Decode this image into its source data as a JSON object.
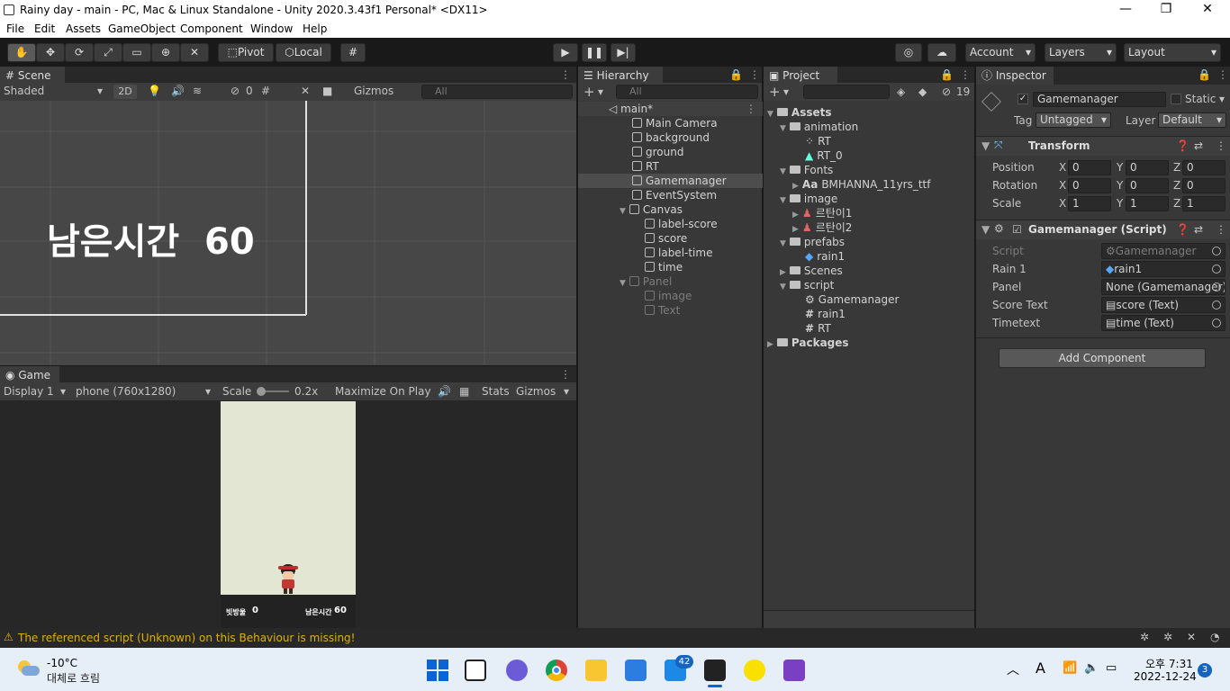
{
  "window": {
    "title": "Rainy day - main - PC, Mac & Linux Standalone - Unity 2020.3.43f1 Personal* <DX11>"
  },
  "menu": [
    "File",
    "Edit",
    "Assets",
    "GameObject",
    "Component",
    "Window",
    "Help"
  ],
  "toolbar": {
    "pivot": "Pivot",
    "local": "Local",
    "account": "Account",
    "layers": "Layers",
    "layout": "Layout"
  },
  "scene": {
    "tab": "Scene",
    "shading": "Shaded",
    "mode2d": "2D",
    "hidden_count": "0",
    "gizmos": "Gizmos",
    "search_placeholder": "All",
    "overlay_text": "남은시간  60"
  },
  "game": {
    "tab": "Game",
    "display": "Display 1",
    "resolution": "phone (760x1280)",
    "scale_label": "Scale",
    "scale_value": "0.2x",
    "maximize": "Maximize On Play",
    "stats": "Stats",
    "gizmos": "Gizmos",
    "score_label": "빗방울",
    "score_value": "0",
    "time_label": "남은시간",
    "time_value": "60"
  },
  "hierarchy": {
    "tab": "Hierarchy",
    "search_placeholder": "All",
    "scene_name": "main*",
    "items": [
      "Main Camera",
      "background",
      "ground",
      "RT",
      "Gamemanager",
      "EventSystem",
      "Canvas",
      "label-score",
      "score",
      "label-time",
      "time",
      "Panel",
      "image",
      "Text"
    ]
  },
  "project": {
    "tab": "Project",
    "hidden_count": "19",
    "items": [
      "Assets",
      "animation",
      "RT",
      "RT_0",
      "Fonts",
      "BMHANNA_11yrs_ttf",
      "image",
      "르탄이1",
      "르탄이2",
      "prefabs",
      "rain1",
      "Scenes",
      "script",
      "Gamemanager",
      "rain1",
      "RT",
      "Packages"
    ]
  },
  "inspector": {
    "tab": "Inspector",
    "object_name": "Gamemanager",
    "static": "Static",
    "tag_label": "Tag",
    "tag": "Untagged",
    "layer_label": "Layer",
    "layer": "Default",
    "transform": {
      "title": "Transform",
      "position": "Position",
      "rotation": "Rotation",
      "scale": "Scale",
      "px": "0",
      "py": "0",
      "pz": "0",
      "rx": "0",
      "ry": "0",
      "rz": "0",
      "sx": "1",
      "sy": "1",
      "sz": "1"
    },
    "script": {
      "title": "Gamemanager (Script)",
      "script_label": "Script",
      "script_value": "Gamemanager",
      "rain_label": "Rain 1",
      "rain_value": "rain1",
      "panel_label": "Panel",
      "panel_value": "None (Gamemanager)",
      "score_label": "Score Text",
      "score_value": "score (Text)",
      "time_label": "Timetext",
      "time_value": "time (Text)"
    },
    "add_component": "Add Component"
  },
  "status": {
    "warning": "The referenced script (Unknown) on this Behaviour is missing!"
  },
  "taskbar": {
    "temp": "-10°C",
    "weather": "대체로 흐림",
    "badge_mail": "42",
    "time": "오후 7:31",
    "date": "2022-12-24",
    "notif": "3",
    "ime": "A"
  }
}
